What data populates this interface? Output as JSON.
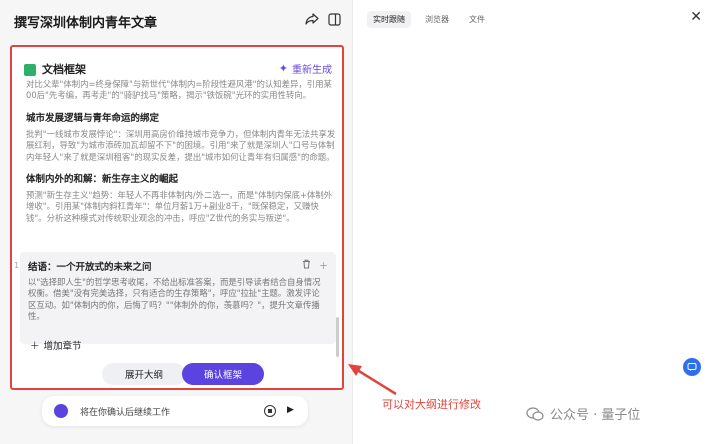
{
  "header": {
    "title": "撰写深圳体制内青年文章",
    "share_icon": "share-icon",
    "split_icon": "split-view-icon"
  },
  "outline": {
    "title": "文档框架",
    "regenerate": "重新生成",
    "intro_text": "对比父辈\"体制内=终身保障\"与新世代\"体制内=阶段性避风港\"的认知差异，引用某00后\"先考编，再考走\"的\"骑驴找马\"策略，揭示\"铁饭碗\"光环的实用性转向。",
    "sections": [
      {
        "title": "城市发展逻辑与青年命运的绑定",
        "text": "批判\"一线城市发展悖论\"：深圳用高房价维持城市竞争力，但体制内青年无法共享发展红利，导致\"为城市添砖加瓦却留不下\"的困境。引用\"来了就是深圳人\"口号与体制内年轻人\"来了就是深圳租客\"的现实反差，提出\"城市如何让青年有归属感\"的命题。"
      },
      {
        "title": "体制内外的和解：新生存主义的崛起",
        "text": "预测\"新生存主义\"趋势：年轻人不再非体制内/外二选一，而是\"体制内保底+体制外增收\"。引用某\"体制内斜杠青年\"：单位月薪1万+副业8千，\"既保稳定，又赚快钱\"。分析这种模式对传统职业观念的冲击，呼应\"Z世代的务实与叛逆\"。"
      }
    ],
    "conclusion": {
      "number": "1",
      "title": "结语：一个开放式的未来之问",
      "text": "以\"选择即人生\"的哲学思考收尾，不给出标准答案，而是引导读者结合自身情况权衡。借美\"没有完美选择，只有适合的生存策略\"，呼应\"拉扯\"主题。激发评论区互动。如\"体制内的你，后悔了吗？\"\"体制外的你，羡慕吗？\"，提升文章传播性。",
      "delete_icon": "trash-icon",
      "add_icon": "plus-icon"
    },
    "add_chapter": "增加章节",
    "expand_button": "展开大纲",
    "confirm_button": "确认框架"
  },
  "chat": {
    "status": "将在你确认后继续工作"
  },
  "right_panel": {
    "tabs": [
      {
        "label": "实时跟随",
        "active": true
      },
      {
        "label": "浏览器",
        "active": false
      },
      {
        "label": "文件",
        "active": false
      }
    ],
    "close": "✕"
  },
  "annotation": {
    "text": "可以对大纲进行修改",
    "color": "#e2443c"
  },
  "watermark": {
    "text": "公众号 · 量子位"
  },
  "colors": {
    "accent": "#5b43e0",
    "highlight_border": "#e2443c",
    "doc_icon": "#2fb06a",
    "float_button": "#2d6ff0"
  }
}
